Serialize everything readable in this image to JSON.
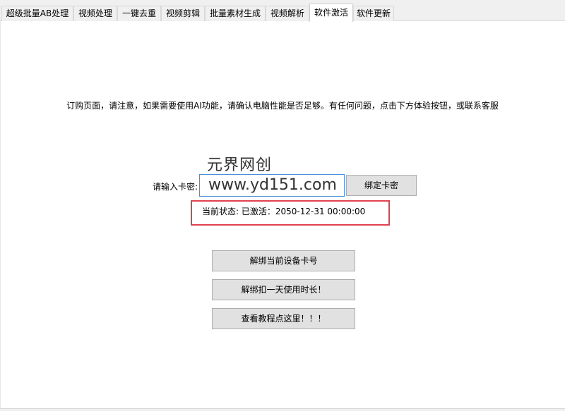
{
  "tabs": [
    {
      "label": "超级批量AB处理"
    },
    {
      "label": "视频处理"
    },
    {
      "label": "一键去重"
    },
    {
      "label": "视频剪辑"
    },
    {
      "label": "批量素材生成"
    },
    {
      "label": "视频解析"
    },
    {
      "label": "软件激活",
      "active": true
    },
    {
      "label": "软件更新"
    }
  ],
  "activation": {
    "notice": "订购页面，请注意，如果需要使用AI功能，请确认电脑性能是否足够。有任何问题，点击下方体验按钮，或联系客服",
    "watermark_title": "元界网创",
    "key_label": "请输入卡密:",
    "key_value": "www.yd151.com",
    "bind_button": "绑定卡密",
    "status": "当前状态: 已激活：2050-12-31 00:00:00",
    "unbind_device_button": "解绑当前设备卡号",
    "unbind_day_button": "解绑扣一天使用时长！",
    "tutorial_button": "查看教程点这里！！！"
  },
  "colors": {
    "status_highlight": "#e0414e",
    "input_border": "#4a90d9",
    "button_face": "#e1e1e1"
  }
}
